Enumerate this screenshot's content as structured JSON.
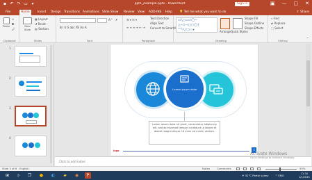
{
  "window": {
    "title": "ppt1_example.pptx - PowerPoint",
    "signin_label": "Sign in",
    "controls": [
      "—",
      "▢",
      "✕"
    ]
  },
  "ribbon_tabs": {
    "file": "File",
    "tabs": [
      "Home",
      "Insert",
      "Design",
      "Transitions",
      "Animations",
      "Slide Show",
      "Review",
      "View",
      "ADD-INS",
      "Help",
      "Tell me what you want to do"
    ],
    "share": "Share",
    "active_index": 0
  },
  "ribbon": {
    "groups": [
      "Clipboard",
      "Slides",
      "Font",
      "Paragraph",
      "Drawing",
      "Editing"
    ],
    "paste": "Paste",
    "new_slide": "New Slide",
    "slide_cmds": [
      "Layout",
      "Reset",
      "Section"
    ],
    "font_cmds": "B  I  U  S  abc  AV  Aa  A",
    "para_cmds": "≡  ≡  ≡  ≡  ⇤  ⇥",
    "text_direction": "Text Direction",
    "align_text": "Align Text",
    "convert_smartart": "Convert to SmartArt",
    "arrange": "Arrange",
    "quick_styles": "Quick Styles",
    "shape_fill": "Shape Fill",
    "shape_outline": "Shape Outline",
    "shape_effects": "Shape Effects",
    "editing_cmds": [
      "Find",
      "Replace",
      "Select"
    ]
  },
  "thumbnails": {
    "numbers": [
      "1",
      "2",
      "3",
      "4"
    ],
    "selected_index": 2
  },
  "slide": {
    "center_label": "Lorem ipsum dolor",
    "note_text": "Lorem ipsum dolor sit amet, consectetur adipiscing elit, sed do eiusmod tempor incididunt ut labore et dolore magna aliqua. Ut enim ad minim veniam.",
    "brand": "logo",
    "page_badge": "3",
    "colors": {
      "left": "#1988d9",
      "middle": "#1a6fcd",
      "right": "#25c4d8"
    },
    "icons": [
      "globe-icon",
      "document-icon",
      "chat-icon"
    ]
  },
  "notes": {
    "placeholder": "Click to add notes"
  },
  "watermark": {
    "line1": "Activate Windows",
    "line2": "Go to Settings to activate Windows."
  },
  "statusbar": {
    "slide_of": "Slide 3 of 6",
    "language": "English",
    "notes": "Notes",
    "comments": "Comments",
    "zoom": "50%"
  },
  "taskbar": {
    "weather": "31°C  Partly sunny",
    "tray": "^  ENG",
    "time": "11:34",
    "date": "1/1/2025"
  }
}
